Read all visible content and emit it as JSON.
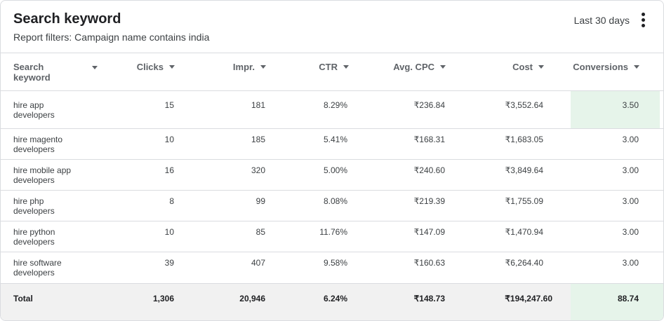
{
  "report": {
    "title": "Search keyword",
    "filters": "Report filters: Campaign name contains india",
    "date_range": "Last 30 days",
    "menu_icon": "more-vert-icon"
  },
  "columns": [
    "Search keyword",
    "Clicks",
    "Impr.",
    "CTR",
    "Avg. CPC",
    "Cost",
    "Conversions"
  ],
  "rows": [
    {
      "keyword": "hire app developers",
      "kw1": "hire app",
      "kw2": "developers",
      "clicks": "15",
      "impr": "181",
      "ctr": "8.29%",
      "cpc": "₹236.84",
      "cost": "₹3,552.64",
      "conv": "3.50"
    },
    {
      "keyword": "hire magento developers",
      "kw1": "hire magento",
      "kw2": "developers",
      "clicks": "10",
      "impr": "185",
      "ctr": "5.41%",
      "cpc": "₹168.31",
      "cost": "₹1,683.05",
      "conv": "3.00"
    },
    {
      "keyword": "hire mobile app developers",
      "kw1": "hire mobile app",
      "kw2": "developers",
      "clicks": "16",
      "impr": "320",
      "ctr": "5.00%",
      "cpc": "₹240.60",
      "cost": "₹3,849.64",
      "conv": "3.00"
    },
    {
      "keyword": "hire php developers",
      "kw1": "hire php",
      "kw2": "developers",
      "clicks": "8",
      "impr": "99",
      "ctr": "8.08%",
      "cpc": "₹219.39",
      "cost": "₹1,755.09",
      "conv": "3.00"
    },
    {
      "keyword": "hire python developers",
      "kw1": "hire python",
      "kw2": "developers",
      "clicks": "10",
      "impr": "85",
      "ctr": "11.76%",
      "cpc": "₹147.09",
      "cost": "₹1,470.94",
      "conv": "3.00"
    },
    {
      "keyword": "hire software developers",
      "kw1": "hire software",
      "kw2": "developers",
      "clicks": "39",
      "impr": "407",
      "ctr": "9.58%",
      "cpc": "₹160.63",
      "cost": "₹6,264.40",
      "conv": "3.00"
    }
  ],
  "total": {
    "label": "Total",
    "clicks": "1,306",
    "impr": "20,946",
    "ctr": "6.24%",
    "cpc": "₹148.73",
    "cost": "₹194,247.60",
    "conv": "88.74"
  },
  "colors": {
    "highlight": "#e6f4ea",
    "total_bg": "#f1f1f1",
    "border": "#dadce0"
  }
}
